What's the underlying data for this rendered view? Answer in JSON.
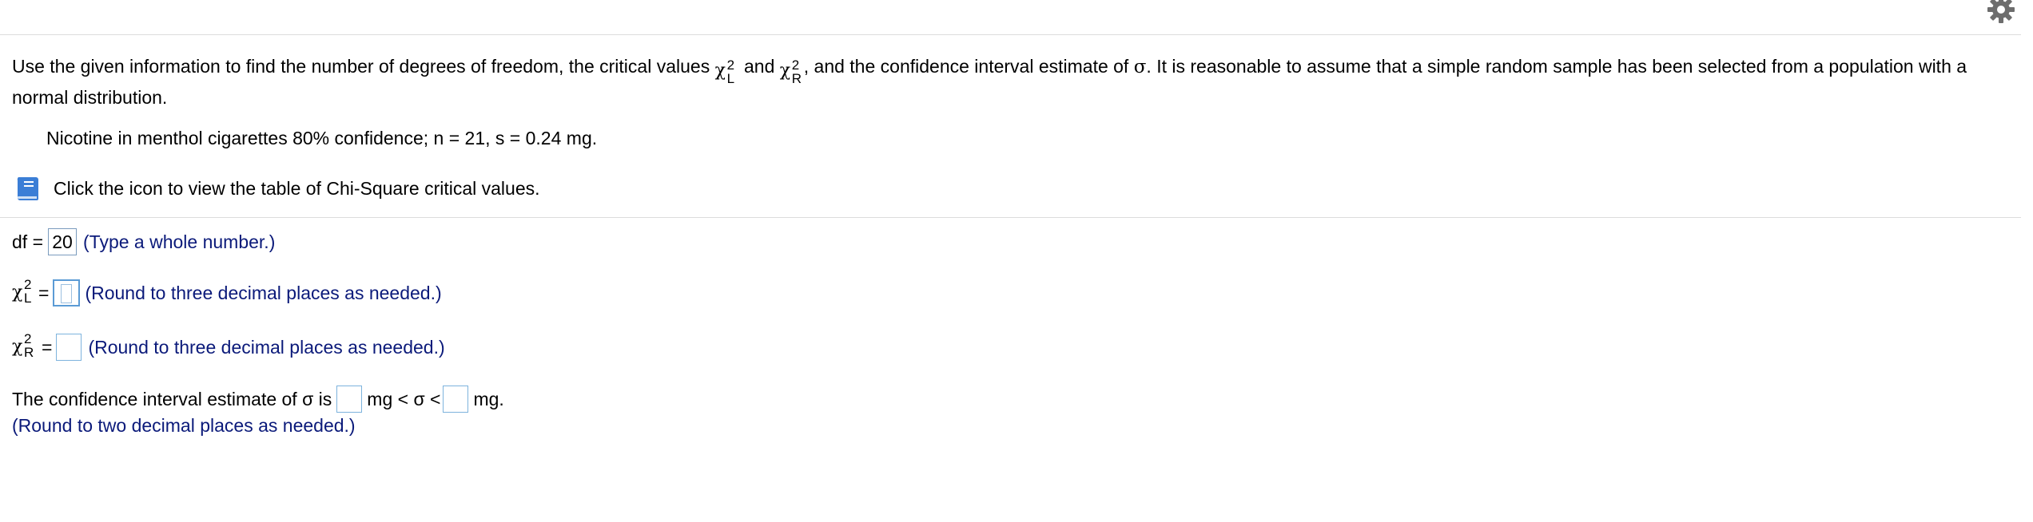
{
  "problem": {
    "intro_part1": "Use the given information to find the number of degrees of freedom, the critical values ",
    "chi_symbol": "χ",
    "chi_sup": "2",
    "chi_sub_left": "L",
    "chi_sub_right": "R",
    "and": " and ",
    "intro_part2": ", and the confidence interval estimate of ",
    "sigma": "σ",
    "intro_part3": ". It is reasonable to assume that a simple random sample has been selected from a population with a normal distribution."
  },
  "given": "Nicotine in menthol cigarettes 80% confidence; n = 21, s = 0.24 mg.",
  "table_link": {
    "icon": "book-icon",
    "label": "Click the icon to view the table of Chi-Square critical values."
  },
  "df_row": {
    "label": "df =",
    "value": "20",
    "hint": "(Type a whole number.)"
  },
  "chi_left_row": {
    "equals": "=",
    "value": "",
    "hint": "(Round to three decimal places as needed.)"
  },
  "chi_right_row": {
    "equals": "=",
    "value": "",
    "hint": "(Round to three decimal places as needed.)"
  },
  "ci_row": {
    "prefix": "The confidence interval estimate of σ is",
    "lower_value": "",
    "middle": "mg < σ <",
    "upper_value": "",
    "suffix": "mg.",
    "hint": "(Round to two decimal places as needed.)"
  },
  "colors": {
    "hint_text": "#0b1a7a",
    "input_border": "#7db3dd",
    "book_icon": "#3b7ed6",
    "gear_icon": "#6d6d6d"
  }
}
